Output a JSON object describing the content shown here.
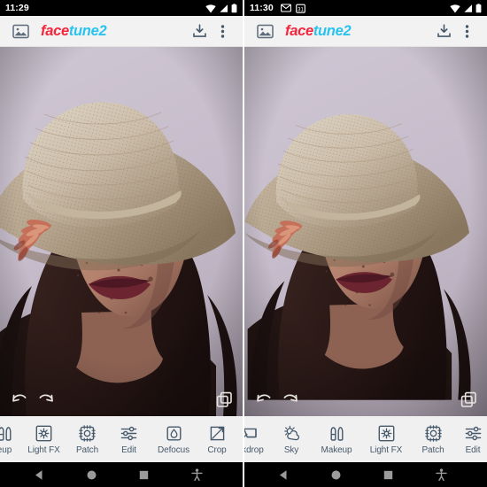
{
  "app": {
    "logo_face": "face",
    "logo_tune": "tune2",
    "accent_red": "#f5263c",
    "accent_cyan": "#29c3f0",
    "icon_color": "#46596b",
    "header_bg": "#f2f2f2",
    "toolbar_bg": "#f0f0f0"
  },
  "panels": [
    {
      "id": "left",
      "status": {
        "time": "11:29",
        "notifications": [],
        "indicators": [
          "wifi-icon",
          "signal-icon",
          "battery-icon"
        ]
      },
      "header": {
        "gallery_icon": "image-thumbnail-icon",
        "download_icon": "download-icon",
        "menu_icon": "overflow-menu-icon"
      },
      "overlay": {
        "undo_icon": "undo-icon",
        "redo_icon": "redo-icon",
        "compare_icon": "compare-layers-icon"
      },
      "tools": [
        {
          "label": "eup",
          "icon": "makeup-icon",
          "full": "Makeup",
          "clipped": true
        },
        {
          "label": "Light FX",
          "icon": "light-fx-icon",
          "full": "Light FX",
          "clipped": false
        },
        {
          "label": "Patch",
          "icon": "patch-icon",
          "full": "Patch",
          "clipped": false
        },
        {
          "label": "Edit",
          "icon": "edit-sliders-icon",
          "full": "Edit",
          "clipped": false
        },
        {
          "label": "Defocus",
          "icon": "defocus-icon",
          "full": "Defocus",
          "clipped": false
        },
        {
          "label": "Crop",
          "icon": "crop-icon",
          "full": "Crop",
          "clipped": false
        }
      ],
      "nav": [
        "back-icon",
        "home-icon",
        "recents-icon",
        "accessibility-icon"
      ]
    },
    {
      "id": "right",
      "status": {
        "time": "11:30",
        "notifications": [
          "mail-icon",
          "calendar-icon"
        ],
        "indicators": [
          "wifi-icon",
          "signal-icon",
          "battery-icon"
        ]
      },
      "header": {
        "gallery_icon": "image-thumbnail-icon",
        "download_icon": "download-icon",
        "menu_icon": "overflow-menu-icon"
      },
      "overlay": {
        "undo_icon": "undo-icon",
        "redo_icon": "redo-icon",
        "compare_icon": "compare-layers-icon"
      },
      "tools": [
        {
          "label": "ckdrop",
          "icon": "backdrop-icon",
          "full": "Backdrop",
          "clipped": true
        },
        {
          "label": "Sky",
          "icon": "sky-icon",
          "full": "Sky",
          "clipped": false
        },
        {
          "label": "Makeup",
          "icon": "makeup-icon",
          "full": "Makeup",
          "clipped": false
        },
        {
          "label": "Light FX",
          "icon": "light-fx-icon",
          "full": "Light FX",
          "clipped": false
        },
        {
          "label": "Patch",
          "icon": "patch-icon",
          "full": "Patch",
          "clipped": false
        },
        {
          "label": "Edit",
          "icon": "edit-sliders-icon",
          "full": "Edit",
          "clipped": true
        }
      ],
      "nav": [
        "back-icon",
        "home-icon",
        "recents-icon",
        "accessibility-icon"
      ]
    }
  ],
  "photo": {
    "subject": "woman-in-straw-hat-portrait",
    "background_color": "#c8c0ce",
    "hat_color": "#cdbfae",
    "skin_color": "#b78a78",
    "hair_color": "#2a1a18",
    "lip_color": "#6b2430",
    "flower_color": "#c4705a",
    "top_color": "#2b1c1a"
  }
}
